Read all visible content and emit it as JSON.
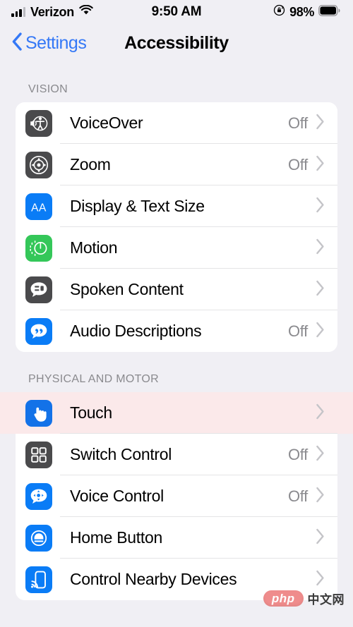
{
  "status_bar": {
    "carrier": "Verizon",
    "time": "9:50 AM",
    "battery_percent": "98%",
    "signal_icon": "cellular-bars-icon",
    "wifi_icon": "wifi-icon",
    "rotation_lock_icon": "rotation-lock-icon",
    "battery_icon": "battery-icon"
  },
  "nav": {
    "back_label": "Settings",
    "back_icon": "chevron-left-icon",
    "title": "Accessibility"
  },
  "sections": [
    {
      "header": "VISION",
      "rows": [
        {
          "label": "VoiceOver",
          "value": "Off",
          "icon": "voiceover-icon",
          "icon_color": "#4a4a4c"
        },
        {
          "label": "Zoom",
          "value": "Off",
          "icon": "zoom-target-icon",
          "icon_color": "#4a4a4c"
        },
        {
          "label": "Display & Text Size",
          "value": "",
          "icon": "display-text-size-icon",
          "icon_color": "#0a7cf6"
        },
        {
          "label": "Motion",
          "value": "",
          "icon": "motion-icon",
          "icon_color": "#34c759"
        },
        {
          "label": "Spoken Content",
          "value": "",
          "icon": "spoken-content-icon",
          "icon_color": "#4a4a4c"
        },
        {
          "label": "Audio Descriptions",
          "value": "Off",
          "icon": "audio-descriptions-icon",
          "icon_color": "#0a7cf6"
        }
      ]
    },
    {
      "header": "PHYSICAL AND MOTOR",
      "rows": [
        {
          "label": "Touch",
          "value": "",
          "icon": "touch-hand-icon",
          "icon_color": "#1372e8",
          "highlighted": true
        },
        {
          "label": "Switch Control",
          "value": "Off",
          "icon": "switch-control-icon",
          "icon_color": "#4a4a4c"
        },
        {
          "label": "Voice Control",
          "value": "Off",
          "icon": "voice-control-icon",
          "icon_color": "#0a7cf6"
        },
        {
          "label": "Home Button",
          "value": "",
          "icon": "home-button-icon",
          "icon_color": "#0a7cf6"
        },
        {
          "label": "Control Nearby Devices",
          "value": "",
          "icon": "nearby-devices-icon",
          "icon_color": "#0a7cf6"
        }
      ]
    }
  ],
  "watermark": {
    "brand": "php",
    "suffix": "中文网"
  },
  "colors": {
    "page_background": "#f0eff4",
    "card_background": "#ffffff",
    "accent_blue": "#3478f6",
    "value_gray": "#8a8a8e",
    "chevron_gray": "#c4c4c8",
    "highlight_pink": "#fbe9ea",
    "separator": "#e4e4e6"
  }
}
